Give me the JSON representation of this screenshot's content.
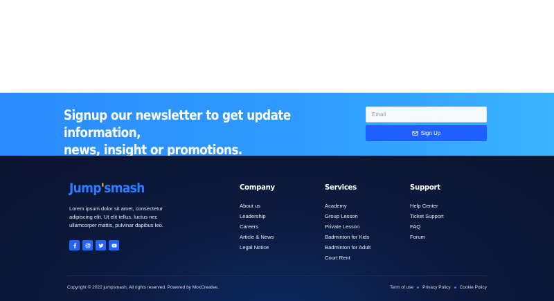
{
  "newsletter": {
    "heading_line1": "Signup our newsletter to get update information,",
    "heading_line2": "news, insight or promotions.",
    "email_placeholder": "Email",
    "signup_label": "Sign Up"
  },
  "brand": {
    "logo_before": "Jump",
    "logo_dot": "'",
    "logo_after": "smash",
    "about": "Lorem ipsum dolor sit amet, consectetur adipiscing elit. Ut elit tellus, luctus nec ullamcorper mattis, pulvinar dapibus leo.",
    "social_icons": [
      "facebook-icon",
      "instagram-icon",
      "twitter-icon",
      "youtube-icon"
    ]
  },
  "columns": {
    "company": {
      "title": "Company",
      "links": [
        "About us",
        "Leadership",
        "Careers",
        "Article & News",
        "Legal Notice"
      ]
    },
    "services": {
      "title": "Services",
      "links": [
        "Academy",
        "Group Lesson",
        "Private Lesson",
        "Badminton for Kids",
        "Badminton for Adult",
        "Court Rent"
      ]
    },
    "support": {
      "title": "Support",
      "links": [
        "Help Center",
        "Ticket Support",
        "FAQ",
        "Forum"
      ]
    }
  },
  "bottom": {
    "copyright": "Copyright © 2022 jumpsmash, All rights reserved. Powered by MoxCreative.",
    "legal": [
      "Term of use",
      "Privacy Policy",
      "Cookie Policy"
    ]
  },
  "colors": {
    "accent": "#2f7bff",
    "button": "#1f5fff",
    "footer_bg": "#0b1a3d",
    "logo_accent": "#f7c52b"
  }
}
